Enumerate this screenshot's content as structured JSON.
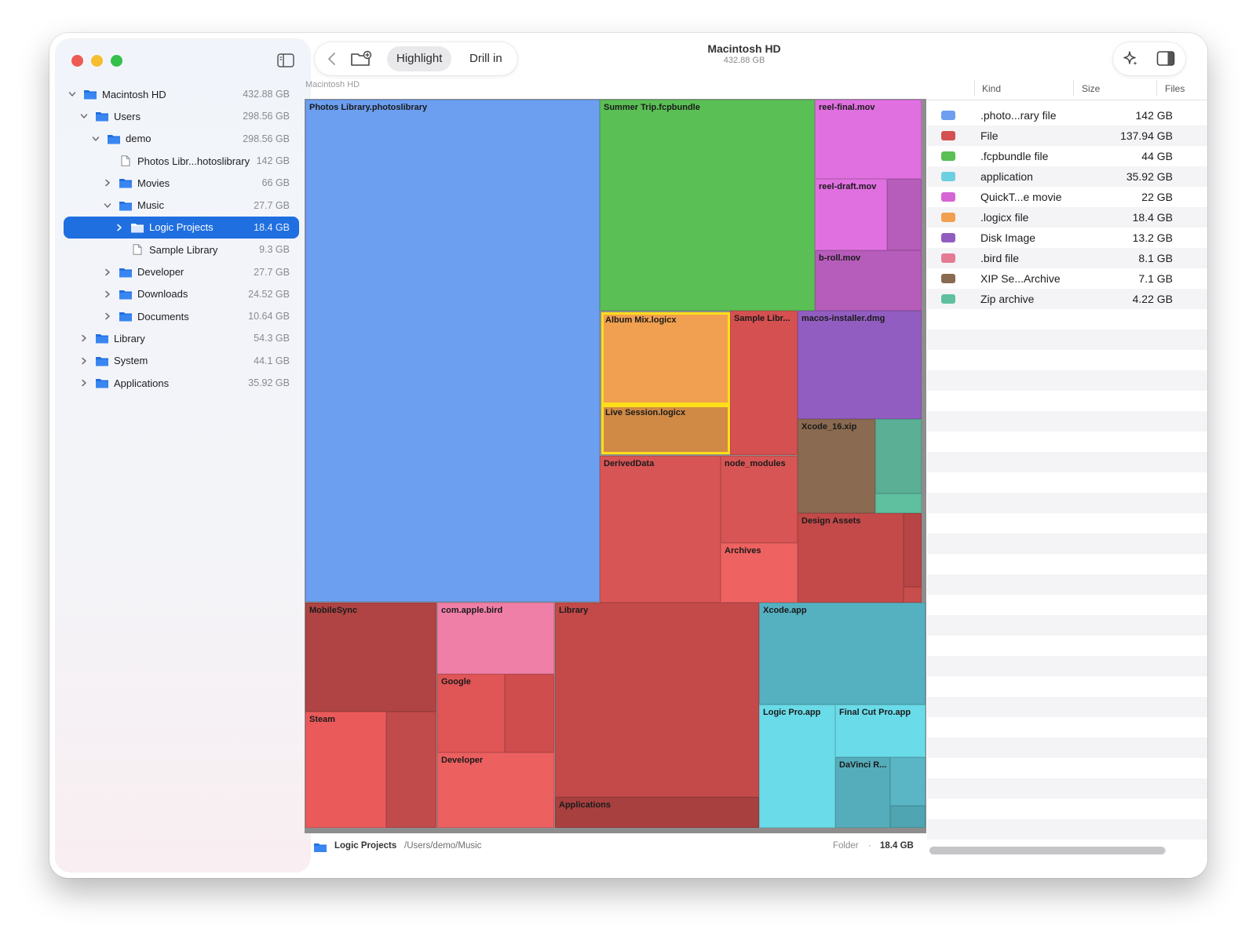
{
  "app": {
    "title": "Macintosh HD",
    "subtitle": "432.88 GB",
    "breadcrumb": "Macintosh HD"
  },
  "toolbar": {
    "highlight_label": "Highlight",
    "drill_label": "Drill in",
    "icons": [
      "back-chevron-icon",
      "new-folder-icon",
      "sparkle-icon",
      "inspector-toggle-icon",
      "sidebar-toggle-icon"
    ]
  },
  "sidebar": {
    "items": [
      {
        "label": "Macintosh HD",
        "size": "432.88 GB",
        "type": "folder",
        "expanded": true,
        "depth": 0
      },
      {
        "label": "Users",
        "size": "298.56 GB",
        "type": "folder",
        "expanded": true,
        "depth": 1
      },
      {
        "label": "demo",
        "size": "298.56 GB",
        "type": "folder",
        "expanded": true,
        "depth": 2
      },
      {
        "label": "Photos Libr...hotoslibrary",
        "size": "142 GB",
        "type": "file",
        "depth": 3
      },
      {
        "label": "Movies",
        "size": "66 GB",
        "type": "folder",
        "expanded": false,
        "depth": 3
      },
      {
        "label": "Music",
        "size": "27.7 GB",
        "type": "folder",
        "expanded": true,
        "depth": 3
      },
      {
        "label": "Logic Projects",
        "size": "18.4 GB",
        "type": "folder",
        "expanded": false,
        "depth": 4,
        "selected": true
      },
      {
        "label": "Sample Library",
        "size": "9.3 GB",
        "type": "file",
        "depth": 4
      },
      {
        "label": "Developer",
        "size": "27.7 GB",
        "type": "folder",
        "expanded": false,
        "depth": 3
      },
      {
        "label": "Downloads",
        "size": "24.52 GB",
        "type": "folder",
        "expanded": false,
        "depth": 3
      },
      {
        "label": "Documents",
        "size": "10.64 GB",
        "type": "folder",
        "expanded": false,
        "depth": 3
      },
      {
        "label": "Library",
        "size": "54.3 GB",
        "type": "folder",
        "expanded": false,
        "depth": 1
      },
      {
        "label": "System",
        "size": "44.1 GB",
        "type": "folder",
        "expanded": false,
        "depth": 1
      },
      {
        "label": "Applications",
        "size": "35.92 GB",
        "type": "folder",
        "expanded": false,
        "depth": 1
      }
    ]
  },
  "treemap": {
    "tiles": [
      {
        "label": "Photos Library.photoslibrary",
        "color": "#6c9ff0"
      },
      {
        "label": "Summer Trip.fcpbundle",
        "color": "#5abf55"
      },
      {
        "label": "reel-final.mov",
        "color": "#e070e0"
      },
      {
        "label": "reel-draft.mov",
        "color": "#e070e0"
      },
      {
        "label": "",
        "color": "#b65cba"
      },
      {
        "label": "b-roll.mov",
        "color": "#b65cba"
      },
      {
        "label": "Album Mix.logicx",
        "color": "#f0a050",
        "selected": true
      },
      {
        "label": "Live Session.logicx",
        "color": "#d08a45",
        "selected": true
      },
      {
        "label": "Sample Libr...",
        "color": "#d55050"
      },
      {
        "label": "macos-installer.dmg",
        "color": "#925dc0"
      },
      {
        "label": "Xcode_16.xip",
        "color": "#8a6a50"
      },
      {
        "label": "",
        "color": "#5aaf95"
      },
      {
        "label": "",
        "color": "#5fc0a0"
      },
      {
        "label": "DerivedData",
        "color": "#d85555"
      },
      {
        "label": "node_modules",
        "color": "#d85555"
      },
      {
        "label": "Archives",
        "color": "#ee6262"
      },
      {
        "label": "Design Assets",
        "color": "#c44a4a"
      },
      {
        "label": "",
        "color": "#b84545"
      },
      {
        "label": "",
        "color": "#c84e4e"
      },
      {
        "label": "MobileSync",
        "color": "#b04444"
      },
      {
        "label": "Steam",
        "color": "#ea5a5a"
      },
      {
        "label": "",
        "color": "#c14a4a"
      },
      {
        "label": "com.apple.bird",
        "color": "#f07fa8"
      },
      {
        "label": "Google",
        "color": "#e05555"
      },
      {
        "label": "",
        "color": "#cf4d4d"
      },
      {
        "label": "Developer",
        "color": "#ec6060"
      },
      {
        "label": "Library",
        "color": "#c44a4a"
      },
      {
        "label": "Applications",
        "color": "#a84040"
      },
      {
        "label": "Xcode.app",
        "color": "#55b0c0"
      },
      {
        "label": "Logic Pro.app",
        "color": "#6adbe8"
      },
      {
        "label": "Final Cut Pro.app",
        "color": "#6adbe8"
      },
      {
        "label": "DaVinci R...",
        "color": "#55adbb"
      },
      {
        "label": "",
        "color": "#5ab5c5"
      },
      {
        "label": "",
        "color": "#4fa5b2"
      }
    ]
  },
  "statusbar": {
    "name": "Logic Projects",
    "path": "/Users/demo/Music",
    "kind": "Folder",
    "separator": "·",
    "size": "18.4 GB"
  },
  "kinds": {
    "headers": {
      "kind": "Kind",
      "size": "Size",
      "files": "Files"
    },
    "rows": [
      {
        "name": ".photo...rary file",
        "size": "142 GB",
        "color": "#6c9ff0"
      },
      {
        "name": "File",
        "size": "137.94 GB",
        "color": "#d55050"
      },
      {
        "name": ".fcpbundle file",
        "size": "44 GB",
        "color": "#5abf55"
      },
      {
        "name": "application",
        "size": "35.92 GB",
        "color": "#6dd0e0"
      },
      {
        "name": "QuickT...e movie",
        "size": "22 GB",
        "color": "#d665d6"
      },
      {
        "name": ".logicx file",
        "size": "18.4 GB",
        "color": "#f0a050"
      },
      {
        "name": "Disk Image",
        "size": "13.2 GB",
        "color": "#925dc0"
      },
      {
        "name": ".bird file",
        "size": "8.1 GB",
        "color": "#e57a95"
      },
      {
        "name": "XIP Se...Archive",
        "size": "7.1 GB",
        "color": "#8a6a50"
      },
      {
        "name": "Zip archive",
        "size": "4.22 GB",
        "color": "#5fc0a0"
      }
    ]
  }
}
